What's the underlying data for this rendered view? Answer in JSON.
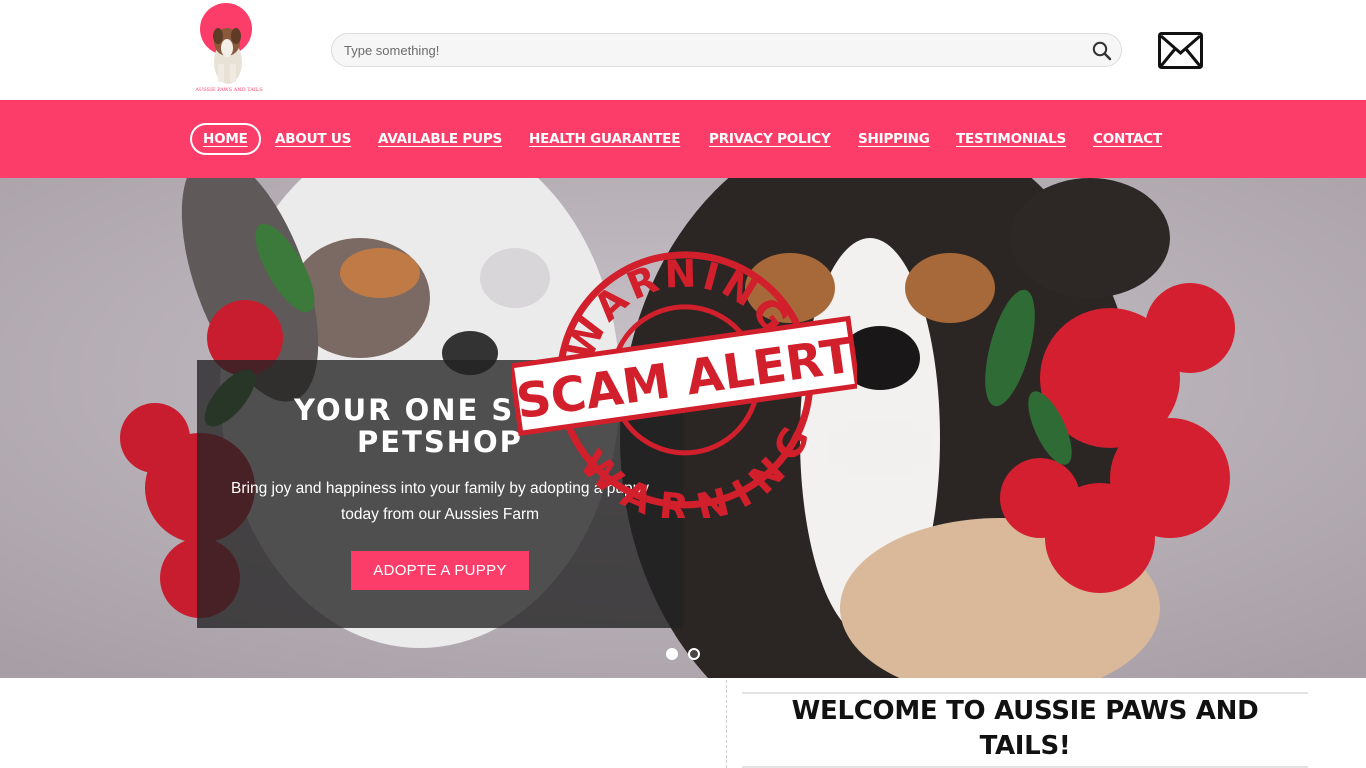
{
  "logo": {
    "text": "AUSSIE PAWS AND TAILS"
  },
  "search": {
    "placeholder": "Type something!",
    "icon": "search-icon"
  },
  "mail": {
    "icon": "envelope-icon"
  },
  "nav": {
    "items": [
      {
        "label": "HOME",
        "active": true
      },
      {
        "label": "ABOUT US"
      },
      {
        "label": "AVAILABLE PUPS"
      },
      {
        "label": "HEALTH GUARANTEE"
      },
      {
        "label": "PRIVACY POLICY"
      },
      {
        "label": "SHIPPING"
      },
      {
        "label": "TESTIMONIALS"
      },
      {
        "label": "CONTACT"
      }
    ]
  },
  "hero": {
    "title_line1": "YOUR ONE STOP",
    "title_line2": "PETSHOP",
    "subtitle_line1": "Bring joy and happiness into your family by adopting a puppy",
    "subtitle_line2": "today from our Aussies Farm",
    "button": "ADOPTE A PUPPY",
    "slides": 2,
    "active_slide": 1
  },
  "stamp": {
    "top": "WARNING",
    "middle": "SCAM ALERT",
    "bottom": "WARNING"
  },
  "welcome": {
    "line1": "WELCOME TO AUSSIE PAWS AND",
    "line2": "TAILS!"
  },
  "colors": {
    "brand": "#fc3d6a",
    "stamp": "#d11f2c"
  }
}
